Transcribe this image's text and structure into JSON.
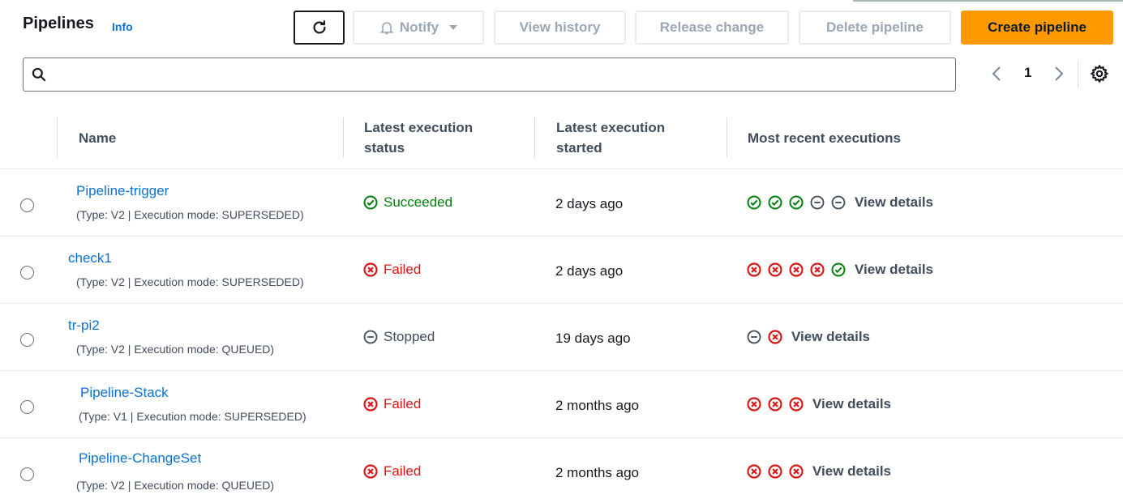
{
  "header": {
    "title": "Pipelines",
    "info_label": "Info",
    "buttons": {
      "notify": "Notify",
      "view_history": "View history",
      "release_change": "Release change",
      "delete_pipeline": "Delete pipeline",
      "create_pipeline": "Create pipeline"
    }
  },
  "search": {
    "placeholder": "",
    "value": ""
  },
  "pagination": {
    "current_page": "1"
  },
  "table": {
    "columns": {
      "name": "Name",
      "status_line1": "Latest execution",
      "status_line2": "status",
      "started_line1": "Latest execution",
      "started_line2": "started",
      "recent": "Most recent executions"
    },
    "rows": [
      {
        "name": "Pipeline-trigger",
        "meta": "(Type: V2 | Execution mode: SUPERSEDED)",
        "status": "Succeeded",
        "started": "2 days ago",
        "recent_label": "View details"
      },
      {
        "name": "check1",
        "meta": "(Type: V2 | Execution mode: SUPERSEDED)",
        "status": "Failed",
        "started": "2 days ago",
        "recent_label": "View details"
      },
      {
        "name": "tr-pi2",
        "meta": "(Type: V2 | Execution mode: QUEUED)",
        "status": "Stopped",
        "started": "19 days ago",
        "recent_label": "View details"
      },
      {
        "name": "Pipeline-Stack",
        "meta": "(Type: V1 | Execution mode: SUPERSEDED)",
        "status": "Failed",
        "started": "2 months ago",
        "recent_label": "View details"
      },
      {
        "name": "Pipeline-ChangeSet",
        "meta": "(Type: V2 | Execution mode: QUEUED)",
        "status": "Failed",
        "started": "2 months ago",
        "recent_label": "View details"
      }
    ]
  },
  "colors": {
    "accent": "#ff9900",
    "link": "#0972d3",
    "success": "#037f0c",
    "error": "#d91515",
    "stopped": "#414d5c"
  }
}
